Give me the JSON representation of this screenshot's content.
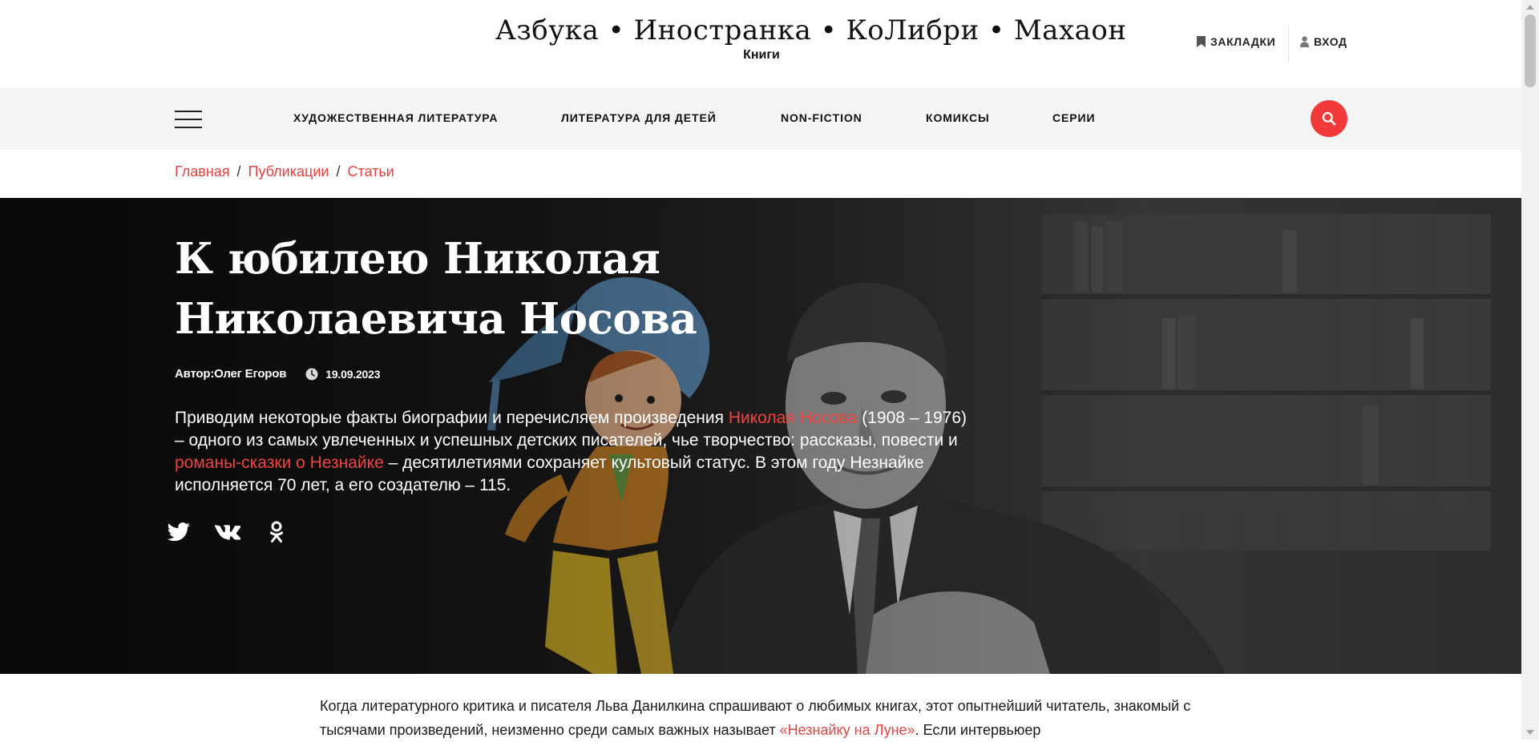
{
  "header": {
    "brand": "Азбука • Иностранка • КоЛибри • Махаон",
    "brand_sub": "Книги",
    "bookmarks_label": "Закладки",
    "login_label": "Вход"
  },
  "nav": {
    "menu_icon": "hamburger-menu-icon",
    "items": [
      {
        "label": "Художественная литература"
      },
      {
        "label": "Литература для детей"
      },
      {
        "label": "Non-fiction"
      },
      {
        "label": "Комиксы"
      },
      {
        "label": "Серии"
      }
    ],
    "search_icon": "search-icon",
    "accent_color": "#f23a3a"
  },
  "breadcrumb": {
    "items": [
      "Главная",
      "Публикации",
      "Статьи"
    ],
    "separator": "/"
  },
  "article": {
    "title": "К юбилею Николая Николаевича Носова",
    "author_line": "Автор:Олег Егоров",
    "date": "19.09.2023",
    "lead": {
      "part1": "Приводим некоторые факты биографии и перечисляем произведения ",
      "link1": "Николая Носова",
      "part2": " (1908 – 1976) – одного из самых увлеченных и успешных детских писателей, чье творчество: рассказы, повести и ",
      "link2": "романы-сказки о Незнайке",
      "part3": " – десятилетиями сохраняет культовый статус. В этом году Незнайке исполняется 70 лет, а его создателю – 115."
    },
    "share": [
      "twitter-icon",
      "vk-icon",
      "odnoklassniki-icon"
    ],
    "body": {
      "part1": "Когда литературного критика и писателя Льва Данилкина спрашивают о любимых книгах, этот опытнейший читатель, знакомый с тысячами произведений, неизменно среди самых важных называет ",
      "link1": "«Незнайку на Луне»",
      "part2": ". Если интервьюер"
    },
    "link_color": "#e8423f"
  }
}
